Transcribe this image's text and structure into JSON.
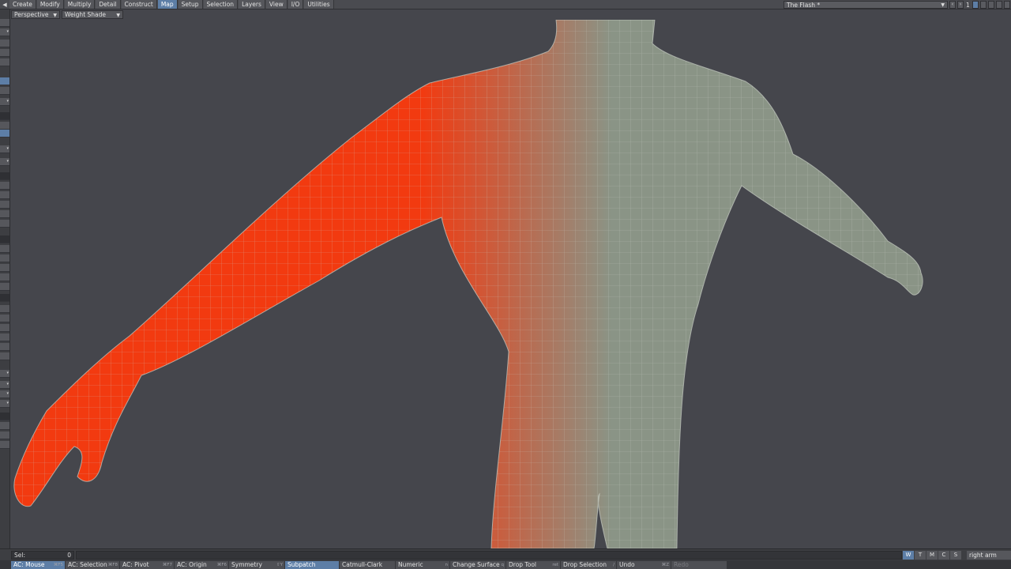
{
  "menu": {
    "tabs": [
      "Create",
      "Modify",
      "Multiply",
      "Detail",
      "Construct",
      "Map",
      "Setup",
      "Selection",
      "Layers",
      "View",
      "I/O",
      "Utilities"
    ],
    "active_tab": "Map"
  },
  "scene": {
    "title": "The Flash *"
  },
  "top_right": {
    "layer_number": "1"
  },
  "viewport": {
    "view_mode": "Perspective",
    "shading_mode": "Weight Shade",
    "colors": {
      "background": "#45464c",
      "mesh_base": "#8a9486",
      "weight": "#f23a10",
      "wire": "#c9cfc6"
    }
  },
  "status": {
    "sel_label": "Sel:",
    "sel_count": "0",
    "view_buttons": [
      "W",
      "T",
      "M",
      "C",
      "S"
    ],
    "active_view_button": "W",
    "weight_map": "right arm"
  },
  "toolbar": {
    "buttons": [
      {
        "label": "AC: Mouse",
        "key": "⌘F5",
        "active": true
      },
      {
        "label": "AC: Selection",
        "key": "⌘F8"
      },
      {
        "label": "AC: Pivot",
        "key": "⌘F7"
      },
      {
        "label": "AC: Origin",
        "key": "⌘F6"
      },
      {
        "label": "Symmetry",
        "key": "⇧Y"
      },
      {
        "label": "Subpatch",
        "active": true
      },
      {
        "label": "Catmull-Clark"
      },
      {
        "label": "Numeric",
        "key": "n"
      },
      {
        "label": "Change Surface",
        "key": "q"
      },
      {
        "label": "Drop Tool",
        "key": "ret"
      },
      {
        "label": "Drop Selection",
        "key": "/"
      },
      {
        "label": "Undo",
        "key": "⌘Z"
      },
      {
        "label": "Redo",
        "disabled": true
      }
    ]
  }
}
